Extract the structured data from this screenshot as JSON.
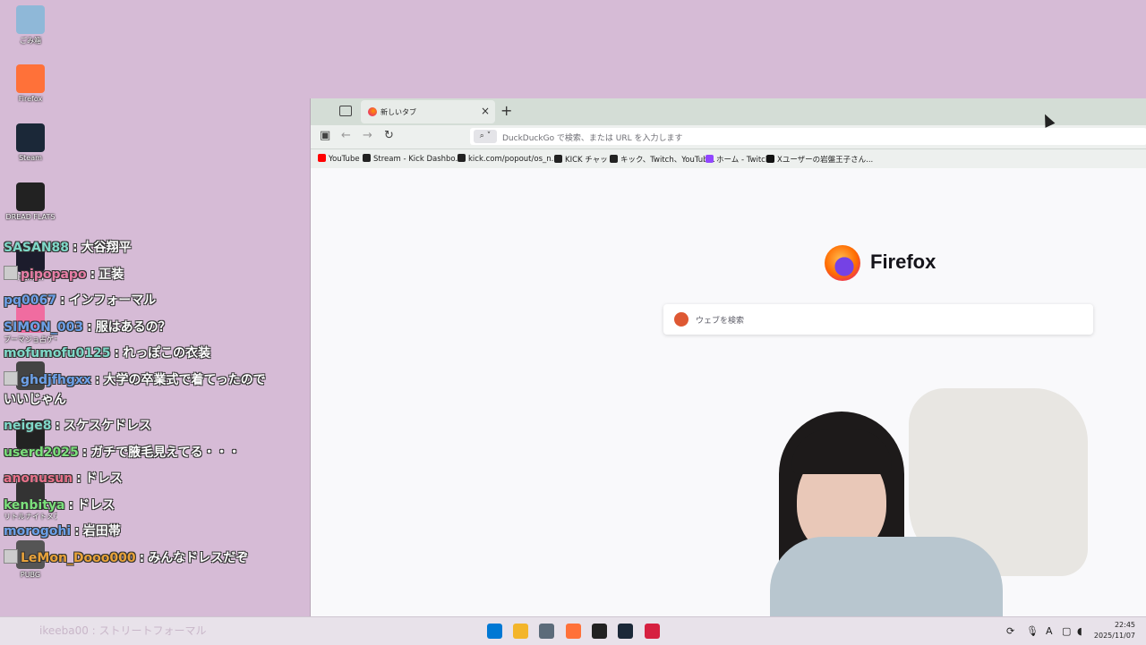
{
  "desktop": {
    "icons": [
      {
        "label": "ごみ箱",
        "icon": "recycle-bin-icon",
        "color": "#8fb8d8"
      },
      {
        "label": "Firefox",
        "icon": "firefox-icon",
        "color": "#ff7139"
      },
      {
        "label": "Steam",
        "icon": "steam-icon",
        "color": "#1b2838"
      },
      {
        "label": "DREAD FLATS",
        "icon": "game-icon",
        "color": "#222222"
      },
      {
        "label": "Human",
        "icon": "app-icon",
        "color": "#1c1c2c"
      },
      {
        "label": "ブーマジョ占ゲーム",
        "icon": "app-icon",
        "color": "#f06ca0"
      },
      {
        "label": "",
        "icon": "app-icon",
        "color": "#444444"
      },
      {
        "label": "",
        "icon": "app-icon",
        "color": "#222222"
      },
      {
        "label": "リトルナイトメア",
        "icon": "app-icon",
        "color": "#333333"
      },
      {
        "label": "PUBG",
        "icon": "app-icon",
        "color": "#555555"
      }
    ]
  },
  "chat": [
    {
      "user": "SASAN88",
      "color": "#7fd8c8",
      "message": "大谷翔平",
      "badge": false
    },
    {
      "user": "pipopapo",
      "color": "#e87ea6",
      "message": "正装",
      "badge": true
    },
    {
      "user": "pq0067",
      "color": "#6ca0e8",
      "message": "インフォーマル",
      "badge": false
    },
    {
      "user": "SIMON_003",
      "color": "#6ca0e8",
      "message": "服はあるの？",
      "badge": false
    },
    {
      "user": "mofumofu0125",
      "color": "#7fd8c8",
      "message": "れっぽこの衣装",
      "badge": false
    },
    {
      "user": "ghdjfhgxx",
      "color": "#6ca0e8",
      "message": "大学の卒業式で着てったのでいいじゃん",
      "badge": true
    },
    {
      "user": "neige8",
      "color": "#7fd8c8",
      "message": "スケスケドレス",
      "badge": false
    },
    {
      "user": "userd2025",
      "color": "#7be07b",
      "message": "ガチで腋毛見えてる・・・",
      "badge": false
    },
    {
      "user": "anonusun",
      "color": "#e8718a",
      "message": "ドレス",
      "badge": false
    },
    {
      "user": "kenbitya",
      "color": "#7be07b",
      "message": "ドレス",
      "badge": false
    },
    {
      "user": "morogohi",
      "color": "#6ca0e8",
      "message": "岩田帯",
      "badge": false
    },
    {
      "user": "LeMon_Dooo000",
      "color": "#e8a23a",
      "message": "みんなドレスだぞ",
      "badge": true
    }
  ],
  "browser": {
    "tab_title": "新しいタブ",
    "url_placeholder": "DuckDuckGo で検索、または URL を入力します",
    "bookmarks": [
      {
        "label": "YouTube",
        "color": "#ff0000"
      },
      {
        "label": "Stream - Kick Dashbo...",
        "color": "#222222"
      },
      {
        "label": "kick.com/popout/os_n...",
        "color": "#222222"
      },
      {
        "label": "KICK チャット",
        "color": "#222222"
      },
      {
        "label": "キック、Twitch、YouTub...",
        "color": "#222222"
      },
      {
        "label": "ホーム - Twitch",
        "color": "#9146ff"
      },
      {
        "label": "Xユーザーの岩盤王子さん...",
        "color": "#111111"
      }
    ],
    "brand": "Firefox",
    "search_placeholder": "ウェブを検索"
  },
  "taskbar": {
    "ghost_text": "ikeeba00 : ストリートフォーマル",
    "apps": [
      {
        "icon": "windows-start-icon",
        "color": "#0078d4"
      },
      {
        "icon": "file-explorer-icon",
        "color": "#f3b52b"
      },
      {
        "icon": "settings-icon",
        "color": "#5c6b7a"
      },
      {
        "icon": "firefox-icon",
        "color": "#ff7139"
      },
      {
        "icon": "obs-icon",
        "color": "#222222"
      },
      {
        "icon": "steam-icon",
        "color": "#1b2838"
      },
      {
        "icon": "app-red-icon",
        "color": "#d62040"
      }
    ],
    "ime": "A",
    "time": "22:45",
    "date": "2025/11/07"
  }
}
